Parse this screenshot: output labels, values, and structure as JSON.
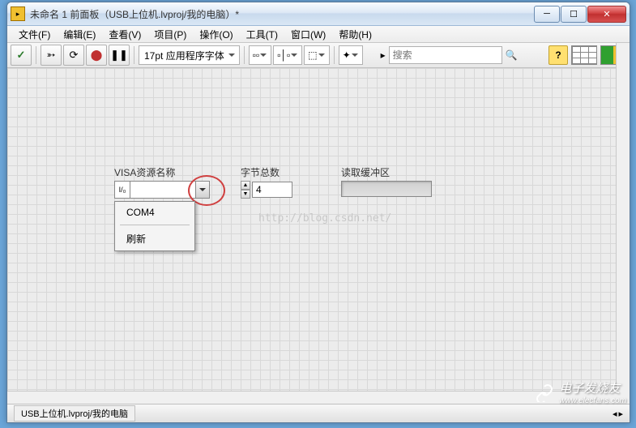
{
  "window": {
    "title": "未命名 1 前面板（USB上位机.lvproj/我的电脑）*",
    "min": "─",
    "max": "☐",
    "close": "✕"
  },
  "menu": {
    "file": "文件(F)",
    "edit": "编辑(E)",
    "view": "查看(V)",
    "project": "项目(P)",
    "operate": "操作(O)",
    "tools": "工具(T)",
    "window": "窗口(W)",
    "help": "帮助(H)"
  },
  "toolbar": {
    "check": "✓",
    "run": "➳",
    "run_cont": "⟳",
    "stop": "⬤",
    "pause": "❚❚",
    "font": "17pt 应用程序字体",
    "align": "▫▫",
    "distribute": "▫│▫",
    "resize": "⬚",
    "order": "✦",
    "search_label": "搜索",
    "search_icon": "🔍",
    "help": "?"
  },
  "controls": {
    "visa": {
      "label": "VISA资源名称",
      "io": "I/₀"
    },
    "bytes": {
      "label": "字节总数",
      "value": "4"
    },
    "buffer": {
      "label": "读取缓冲区"
    }
  },
  "dropdown": {
    "item1": "COM4",
    "item2": "刷新"
  },
  "status": {
    "path": "USB上位机.lvproj/我的电脑"
  },
  "watermark": {
    "url": "http://blog.csdn.net/",
    "brand": "电子发烧友",
    "site": "www.elecfans.com"
  }
}
